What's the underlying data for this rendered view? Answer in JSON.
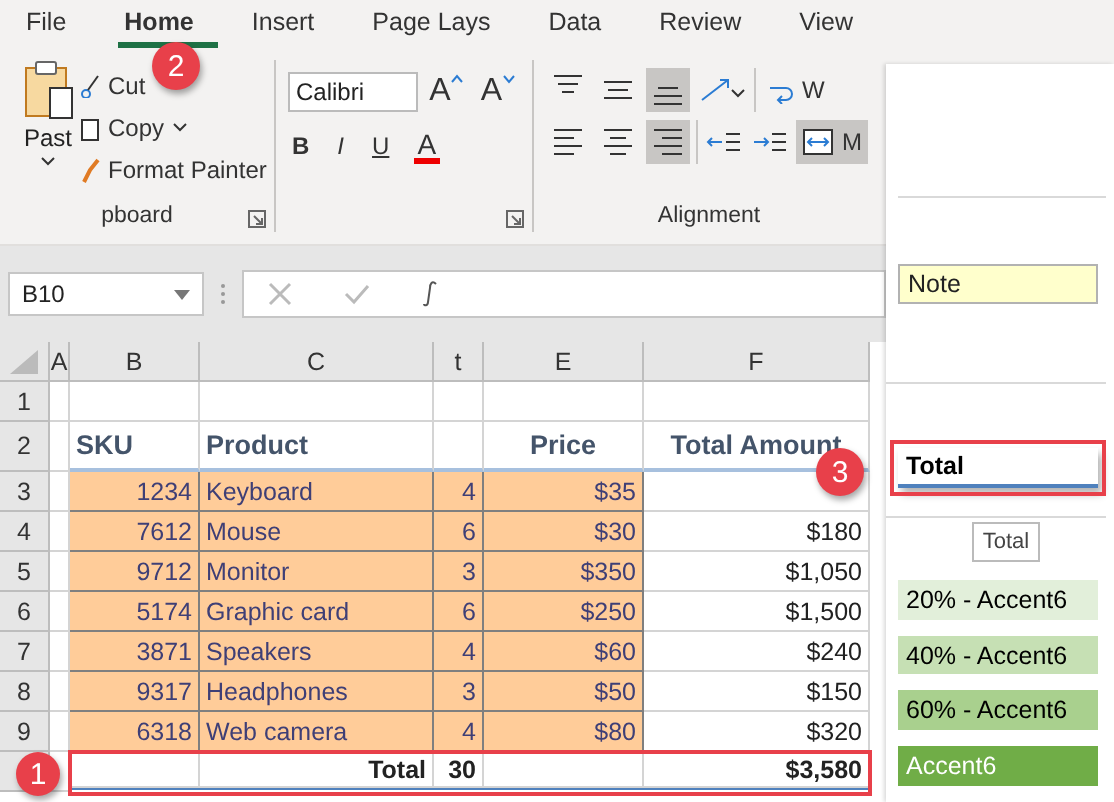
{
  "menu_tabs": [
    {
      "label": "File",
      "selected": false
    },
    {
      "label": "Home",
      "selected": true
    },
    {
      "label": "Insert",
      "selected": false
    },
    {
      "label": "Page Lays",
      "selected": false
    },
    {
      "label": "Data",
      "selected": false
    },
    {
      "label": "Review",
      "selected": false
    },
    {
      "label": "View",
      "selected": false
    }
  ],
  "clipboard": {
    "paste": "Past",
    "cut": "Cut",
    "copy": "Copy",
    "format_painter": "Format Painter",
    "group_label": "pboard"
  },
  "font": {
    "name": "Calibri",
    "grow": "A",
    "shrink": "A",
    "bold": "B",
    "italic": "I",
    "underline": "U",
    "color_letter": "A"
  },
  "alignment": {
    "group_label": "Alignment",
    "wrap": "W",
    "merge": "M",
    "merge_selected": true,
    "buttons": [
      {
        "kind": "top",
        "selected": false
      },
      {
        "kind": "middle",
        "selected": false
      },
      {
        "kind": "bottom",
        "selected": true
      },
      {
        "kind": "left",
        "selected": false
      },
      {
        "kind": "center",
        "selected": false
      },
      {
        "kind": "right",
        "selected": true
      }
    ]
  },
  "name_box": "B10",
  "column_headers": [
    "A",
    "B",
    "C",
    "t",
    "E",
    "F"
  ],
  "rows": [
    {
      "number": "1",
      "kind": "empty",
      "cells": [
        "",
        "",
        "",
        "",
        ""
      ]
    },
    {
      "number": "2",
      "kind": "header",
      "cells": [
        "SKU",
        "Product",
        "",
        "Price",
        "Total Amount"
      ]
    },
    {
      "number": "3",
      "kind": "data",
      "cells": [
        "1234",
        "Keyboard",
        "4",
        "$35",
        ""
      ]
    },
    {
      "number": "4",
      "kind": "data",
      "cells": [
        "7612",
        "Mouse",
        "6",
        "$30",
        "$180"
      ]
    },
    {
      "number": "5",
      "kind": "data",
      "cells": [
        "9712",
        "Monitor",
        "3",
        "$350",
        "$1,050"
      ]
    },
    {
      "number": "6",
      "kind": "data",
      "cells": [
        "5174",
        "Graphic card",
        "6",
        "$250",
        "$1,500"
      ]
    },
    {
      "number": "7",
      "kind": "data",
      "cells": [
        "3871",
        "Speakers",
        "4",
        "$60",
        "$240"
      ]
    },
    {
      "number": "8",
      "kind": "data",
      "cells": [
        "9317",
        "Headphones",
        "3",
        "$50",
        "$150"
      ]
    },
    {
      "number": "9",
      "kind": "data",
      "cells": [
        "6318",
        "Web camera",
        "4",
        "$80",
        "$320"
      ]
    },
    {
      "kind": "total",
      "cells": [
        "",
        "Total",
        "30",
        "",
        "$3,580"
      ]
    }
  ],
  "callouts": [
    "1",
    "2",
    "3"
  ],
  "style_gallery": [
    {
      "label": "Note",
      "kind": "note",
      "color": "#ffffcc",
      "highlighted": false
    },
    {
      "label": "Total",
      "kind": "total",
      "highlighted": true
    },
    {
      "label": "Total",
      "kind": "tooltip"
    },
    {
      "label": "20% - Accent6",
      "kind": "accent",
      "color": "#e2efda",
      "highlighted": false
    },
    {
      "label": "40% - Accent6",
      "kind": "accent",
      "color": "#c6e0b4",
      "highlighted": false
    },
    {
      "label": "60% - Accent6",
      "kind": "accent",
      "color": "#a9d08e",
      "highlighted": false
    },
    {
      "label": "Accent6",
      "kind": "accent-solid",
      "color": "#70ad47",
      "highlighted": false
    }
  ]
}
